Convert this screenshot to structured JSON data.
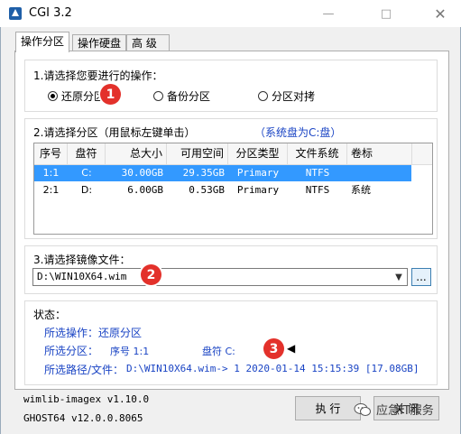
{
  "window": {
    "title": "CGI 3.2",
    "min_icon": "minimize-icon",
    "max_icon": "maximize-icon",
    "close_icon": "close-icon"
  },
  "tabs": [
    {
      "label": "操作分区",
      "active": true
    },
    {
      "label": "操作硬盘",
      "active": false
    },
    {
      "label": "高  级",
      "active": false
    }
  ],
  "section1": {
    "label": "1.请选择您要进行的操作：",
    "options": [
      {
        "label": "还原分区",
        "checked": true
      },
      {
        "label": "备份分区",
        "checked": false
      },
      {
        "label": "分区对拷",
        "checked": false
      }
    ]
  },
  "section2": {
    "label": "2.请选择分区（用鼠标左键单击）",
    "system_disk_note": "（系统盘为C:盘）",
    "columns": [
      "序号",
      "盘符",
      "总大小",
      "可用空间",
      "分区类型",
      "文件系统",
      "卷标"
    ],
    "rows": [
      {
        "index": "1:1",
        "drive": "C:",
        "total": "30.00GB",
        "free": "29.35GB",
        "type": "Primary",
        "fs": "NTFS",
        "label": "",
        "selected": true
      },
      {
        "index": "2:1",
        "drive": "D:",
        "total": "6.00GB",
        "free": "0.53GB",
        "type": "Primary",
        "fs": "NTFS",
        "label": "系统",
        "selected": false
      }
    ]
  },
  "section3": {
    "label": "3.请选择镜像文件：",
    "image_path": "D:\\WIN10X64.wim",
    "browse_label": "..."
  },
  "status": {
    "label": "状态：",
    "operation_label": "所选操作：",
    "operation_value": "还原分区",
    "partition_label": "所选分区：",
    "partition_index": "序号 1:1",
    "partition_drive": "盘符 C:",
    "path_label": "所选路径/文件：",
    "path_value": "D:\\WIN10X64.wim->  1  2020-01-14 15:15:39 [17.08GB]"
  },
  "footer": {
    "wimlib": "wimlib-imagex v1.10.0",
    "ghost": "GHOST64 v12.0.0.8065",
    "execute_label": "执 行",
    "close_label": "关 闭"
  },
  "annotations": [
    "1",
    "2",
    "3"
  ],
  "watermark": "应急IT服务",
  "colors": {
    "accent": "#3399ff",
    "blue_text": "#1a44c4",
    "badge": "#e3312b"
  }
}
